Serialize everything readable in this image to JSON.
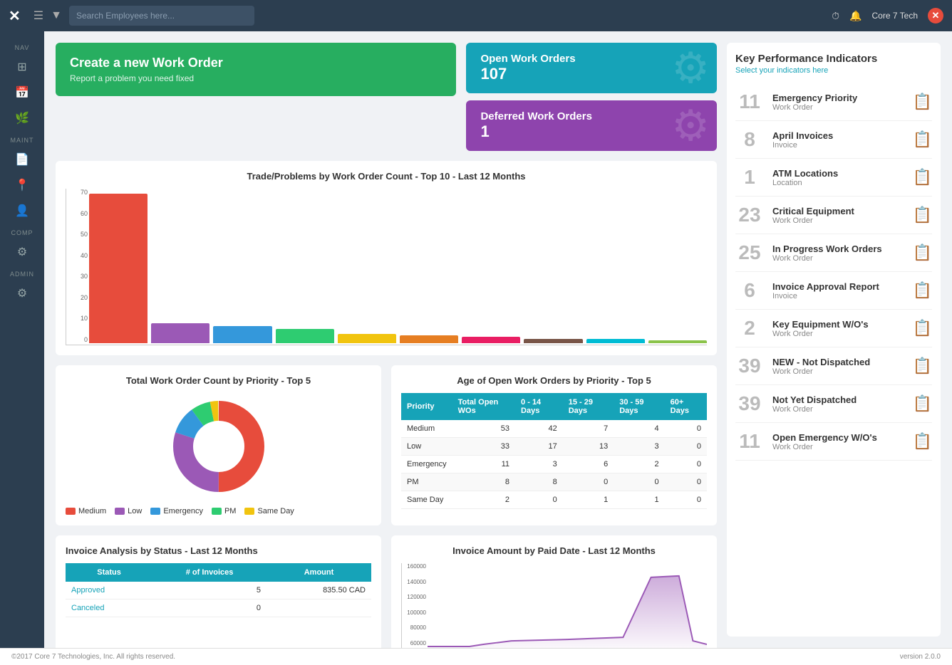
{
  "app": {
    "logo": "✕",
    "search_placeholder": "Search Employees here...",
    "user": "Core 7 Tech",
    "version": "version 2.0.0",
    "footer_copy": "©2017 Core 7 Technologies, Inc. All rights reserved."
  },
  "sidebar": {
    "nav_label": "NAV",
    "maint_label": "MAINT",
    "comp_label": "COMP",
    "admin_label": "ADMIN"
  },
  "cards": {
    "create_title": "Create a new Work Order",
    "create_sub": "Report a problem you need fixed",
    "open_title": "Open Work Orders",
    "open_count": "107",
    "deferred_title": "Deferred Work Orders",
    "deferred_count": "1"
  },
  "bar_chart": {
    "title": "Trade/Problems by Work Order Count - Top 10 - Last 12 Months",
    "y_labels": [
      "0",
      "10",
      "20",
      "30",
      "40",
      "50",
      "60",
      "70"
    ],
    "bars": [
      {
        "height_pct": 97,
        "color": "#e74c3c"
      },
      {
        "height_pct": 13,
        "color": "#9b59b6"
      },
      {
        "height_pct": 11,
        "color": "#3498db"
      },
      {
        "height_pct": 9,
        "color": "#2ecc71"
      },
      {
        "height_pct": 6,
        "color": "#f1c40f"
      },
      {
        "height_pct": 5,
        "color": "#e67e22"
      },
      {
        "height_pct": 4,
        "color": "#e91e63"
      },
      {
        "height_pct": 3,
        "color": "#795548"
      },
      {
        "height_pct": 3,
        "color": "#00bcd4"
      },
      {
        "height_pct": 2,
        "color": "#8bc34a"
      }
    ]
  },
  "priority_chart": {
    "title": "Total Work Order Count by Priority - Top 5",
    "segments": [
      {
        "label": "Medium",
        "color": "#e74c3c",
        "pct": 50
      },
      {
        "label": "Low",
        "color": "#9b59b6",
        "pct": 30
      },
      {
        "label": "Emergency",
        "color": "#3498db",
        "pct": 10
      },
      {
        "label": "PM",
        "color": "#2ecc71",
        "pct": 7
      },
      {
        "label": "Same Day",
        "color": "#f1c40f",
        "pct": 3
      }
    ]
  },
  "age_table": {
    "title": "Age of Open Work Orders by Priority - Top 5",
    "headers": [
      "Priority",
      "Total Open WOs",
      "0 - 14 Days",
      "15 - 29 Days",
      "30 - 59 Days",
      "60+ Days"
    ],
    "rows": [
      [
        "Medium",
        "53",
        "42",
        "7",
        "4",
        "0"
      ],
      [
        "Low",
        "33",
        "17",
        "13",
        "3",
        "0"
      ],
      [
        "Emergency",
        "11",
        "3",
        "6",
        "2",
        "0"
      ],
      [
        "PM",
        "8",
        "8",
        "0",
        "0",
        "0"
      ],
      [
        "Same Day",
        "2",
        "0",
        "1",
        "1",
        "0"
      ]
    ]
  },
  "invoice_table": {
    "title": "Invoice Analysis by Status - Last 12 Months",
    "headers": [
      "Status",
      "# of Invoices",
      "Amount"
    ],
    "rows": [
      [
        "Approved",
        "5",
        "835.50 CAD"
      ],
      [
        "Canceled",
        "0",
        ""
      ]
    ]
  },
  "line_chart": {
    "title": "Invoice Amount by Paid Date - Last 12 Months",
    "y_labels": [
      "60000",
      "80000",
      "100000",
      "120000",
      "140000",
      "160000"
    ],
    "peak_x": 0.82,
    "peak_y": 0.9
  },
  "kpi": {
    "title": "Key Performance Indicators",
    "subtitle": "Select your indicators here",
    "items": [
      {
        "num": "11",
        "title": "Emergency Priority",
        "sub": "Work Order"
      },
      {
        "num": "8",
        "title": "April Invoices",
        "sub": "Invoice"
      },
      {
        "num": "1",
        "title": "ATM Locations",
        "sub": "Location"
      },
      {
        "num": "23",
        "title": "Critical Equipment",
        "sub": "Work Order"
      },
      {
        "num": "25",
        "title": "In Progress Work Orders",
        "sub": "Work Order"
      },
      {
        "num": "6",
        "title": "Invoice Approval Report",
        "sub": "Invoice"
      },
      {
        "num": "2",
        "title": "Key Equipment W/O's",
        "sub": "Work Order"
      },
      {
        "num": "39",
        "title": "NEW - Not Dispatched",
        "sub": "Work Order"
      },
      {
        "num": "39",
        "title": "Not Yet Dispatched",
        "sub": "Work Order"
      },
      {
        "num": "11",
        "title": "Open Emergency W/O's",
        "sub": "Work Order"
      }
    ]
  }
}
